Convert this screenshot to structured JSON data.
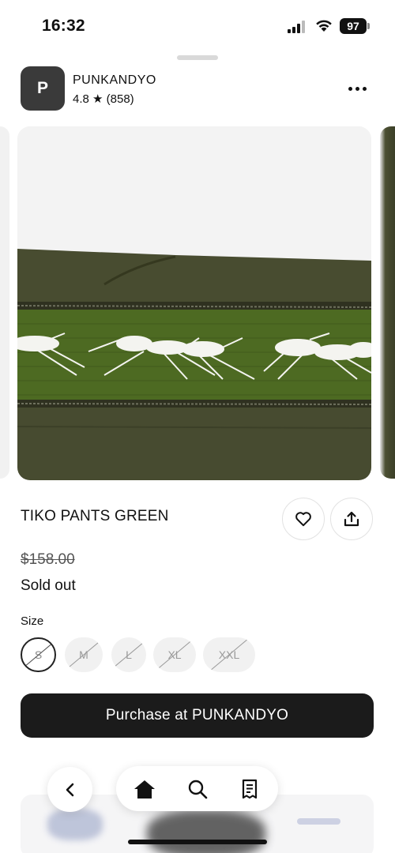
{
  "status_bar": {
    "time": "16:32",
    "battery": "97",
    "icons": [
      "signal-icon",
      "wifi-icon",
      "battery-icon"
    ]
  },
  "shop": {
    "avatar_letter": "P",
    "name": "PUNKANDYO",
    "rating": "4.8 ★ (858)"
  },
  "product": {
    "title": "TIKO PANTS GREEN",
    "original_price": "$158.00",
    "availability": "Sold out",
    "image_icon": "product-photo-green-pants-mosquito-print"
  },
  "size": {
    "label": "Size",
    "options": [
      {
        "label": "S",
        "selected": true,
        "available": false
      },
      {
        "label": "M",
        "selected": false,
        "available": false
      },
      {
        "label": "L",
        "selected": false,
        "available": false
      },
      {
        "label": "XL",
        "selected": false,
        "available": false
      },
      {
        "label": "XXL",
        "selected": false,
        "available": false
      }
    ]
  },
  "actions": {
    "purchase_label": "Purchase at PUNKANDYO",
    "like_icon": "heart-icon",
    "share_icon": "share-icon"
  },
  "bottom_nav": {
    "back_icon": "chevron-left-icon",
    "items": [
      "home-icon",
      "search-icon",
      "receipt-icon"
    ]
  },
  "colors": {
    "fabric_green": "#3f4429",
    "mesh_green": "#4d6a22",
    "print_white": "#f4f4f0",
    "button_dark": "#1b1b1b"
  }
}
